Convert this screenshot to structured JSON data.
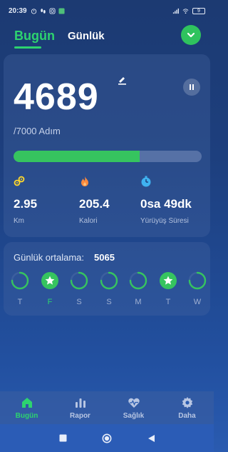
{
  "status_bar": {
    "time": "20:39",
    "battery": "9"
  },
  "tabs": [
    {
      "label": "Bugün",
      "active": true
    },
    {
      "label": "Günlük",
      "active": false
    }
  ],
  "steps": {
    "value": "4689",
    "goal_text": "/7000 Adım",
    "progress": 0.67
  },
  "stats": [
    {
      "icon": "distance-icon",
      "value": "2.95",
      "label": "Km",
      "color": "#f5d130"
    },
    {
      "icon": "flame-icon",
      "value": "205.4",
      "label": "Kalori",
      "color": "#ff8a3d"
    },
    {
      "icon": "timer-icon",
      "value": "0sa 49dk",
      "label": "Yürüyüş Süresi",
      "color": "#3fb2f0"
    }
  ],
  "daily_average": {
    "label": "Günlük ortalama:",
    "value": "5065"
  },
  "days": [
    {
      "label": "T",
      "state": "partial"
    },
    {
      "label": "F",
      "state": "done"
    },
    {
      "label": "S",
      "state": "partial"
    },
    {
      "label": "S",
      "state": "partial"
    },
    {
      "label": "M",
      "state": "partial"
    },
    {
      "label": "T",
      "state": "done"
    },
    {
      "label": "W",
      "state": "partial"
    }
  ],
  "bottom_nav": [
    {
      "label": "Bugün",
      "icon": "home-icon",
      "active": true
    },
    {
      "label": "Rapor",
      "icon": "bar-chart-icon",
      "active": false
    },
    {
      "label": "Sağlık",
      "icon": "heartbeat-icon",
      "active": false
    },
    {
      "label": "Daha",
      "icon": "gear-icon",
      "active": false
    }
  ],
  "colors": {
    "accent": "#2dd36f",
    "progress": "#36c45f",
    "background": "#1d3f7e"
  }
}
